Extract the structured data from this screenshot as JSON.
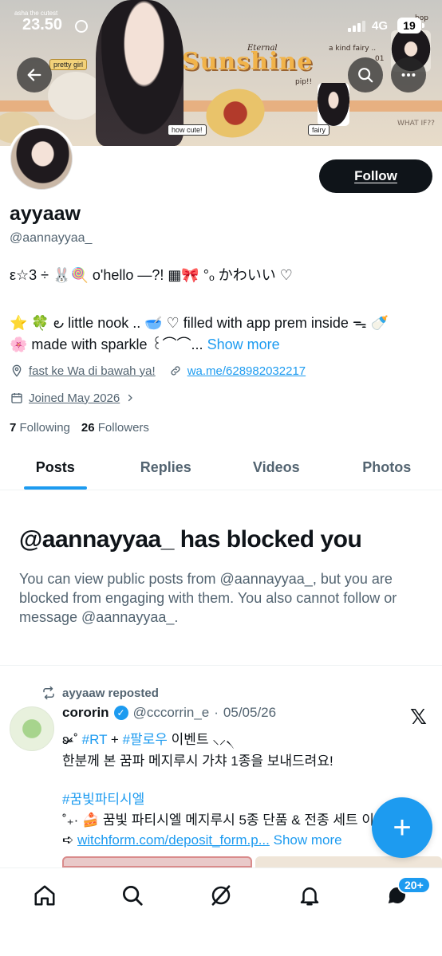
{
  "status_bar": {
    "caption": "asha the cutest",
    "time": "23.50",
    "network": "4G",
    "battery": "19"
  },
  "banner": {
    "title": "Sunshine",
    "eternal": "Eternal",
    "stickers": [
      "pretty girl",
      "how cute!",
      "fairy",
      "pip!!",
      "a kind fairy ..",
      "01",
      "bop",
      "WHAT IF??"
    ]
  },
  "profile": {
    "follow_label": "Follow",
    "display_name": "ayyaaw",
    "handle": "@aannayyaa_",
    "bio_line1": "ε☆3 ÷ 🐰🍭 o'hello —?! ▦🎀 °ₒ かわいい ♡",
    "bio_line2": "⭐ 🍀 ౿ little nook .. 🥣 ♡ filled with app prem inside ᯓ 🍼",
    "bio_line3": "🌸 made with sparkle ꒰⌒⌒...",
    "show_more": "Show more",
    "location": "fast ke Wa di bawah ya!",
    "website": "wa.me/628982032217",
    "joined": "Joined May 2026",
    "following_count": "7",
    "following_label": "Following",
    "followers_count": "26",
    "followers_label": "Followers"
  },
  "tabs": [
    "Posts",
    "Replies",
    "Videos",
    "Photos"
  ],
  "blocked": {
    "title": "@aannayyaa_ has blocked you",
    "description": "You can view public posts from @aannayyaa_, but you are blocked from engaging with them. You also cannot follow or message @aannayyaa_."
  },
  "post": {
    "repost_label": "ayyaaw reposted",
    "author_name": "cororin",
    "author_handle": "@cccorrin_e",
    "date": "05/05/26",
    "line1_prefix": "ʚ̴̶̷̷·˚ ",
    "tag_rt": "#RT",
    "plus": " + ",
    "tag_follow": "#팔로우",
    "line1_suffix": " 이벤트 ⸜⸝৲",
    "line2": "한분께 본 꿈파 메지루시 가챠 1종을 보내드려요!",
    "line3": "#꿈빛파티시엘",
    "line4": "˚₊· 🍰 꿈빛 파티시엘 메지루시 5종 단품 & 전종 세트 이",
    "line5_prefix": "➪ ",
    "link": "witchform.com/deposit_form.p...",
    "show_more": " Show more"
  },
  "fab_label": "+",
  "nav": {
    "badge": "20+",
    "icons": [
      "home-icon",
      "search-icon",
      "grok-icon",
      "notifications-icon",
      "messages-icon"
    ]
  },
  "colors": {
    "accent": "#1d9bf0",
    "text": "#0f1419",
    "muted": "#536471"
  }
}
